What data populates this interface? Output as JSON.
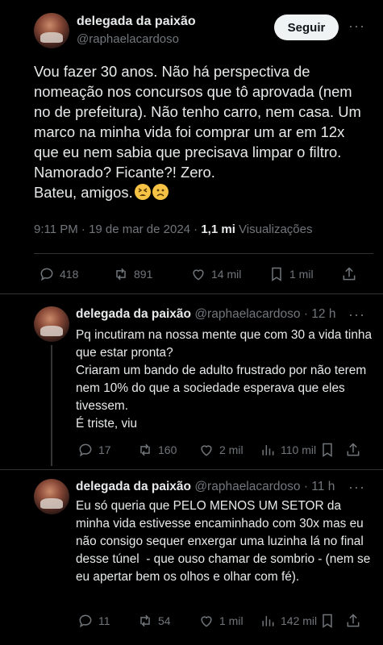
{
  "main_tweet": {
    "display_name": "delegada da paixão",
    "handle": "@raphaelacardoso",
    "follow_label": "Seguir",
    "text": "Vou fazer 30 anos. Não há perspectiva de nomeação nos concursos que tô aprovada (nem no de prefeitura). Não tenho carro, nem casa. Um marco na minha vida foi comprar um ar em 12x que eu nem sabia que precisava limpar o filtro. Namorado? Ficante?! Zero.\nBateu, amigos.",
    "emojis": [
      "tired-face",
      "frowning-face"
    ],
    "time": "9:11 PM · 19 de mar de 2024 · ",
    "views_count": "1,1 mi",
    "views_label": "Visualizações",
    "stats": {
      "replies": "418",
      "reposts": "891",
      "likes": "14 mil",
      "bookmarks": "1 mil"
    }
  },
  "replies": [
    {
      "display_name": "delegada da paixão",
      "handle": "@raphaelacardoso",
      "time": "· 12 h",
      "text": "Pq incutiram na nossa mente que com 30 a vida tinha que estar pronta?\nCriaram um bando de adulto frustrado por não terem nem 10% do que a sociedade esperava que eles tivessem.\nÉ triste, viu",
      "stats": {
        "replies": "17",
        "reposts": "160",
        "likes": "2 mil",
        "views": "110 mil"
      }
    },
    {
      "display_name": "delegada da paixão",
      "handle": "@raphaelacardoso",
      "time": "· 11 h",
      "text": "Eu só queria que PELO MENOS UM SETOR da minha vida estivesse encaminhado com 30x mas eu não consigo sequer enxergar uma luzinha lá no final desse túnel  - que ouso chamar de sombrio - (nem se eu apertar bem os olhos e olhar com fé).",
      "stats": {
        "replies": "11",
        "reposts": "54",
        "likes": "1 mil",
        "views": "142 mil"
      }
    }
  ]
}
